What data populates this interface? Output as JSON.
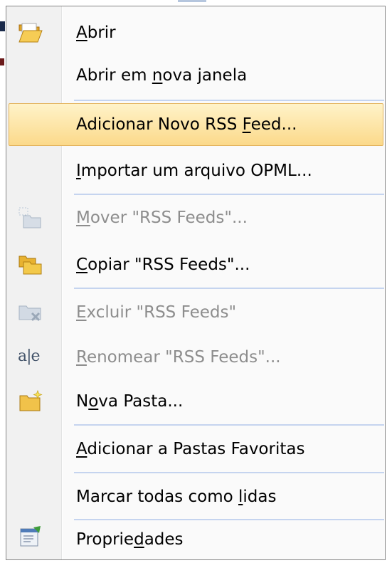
{
  "menu": {
    "items": [
      {
        "pre": "",
        "u": "A",
        "post": "brir",
        "icon": "folder-open-icon",
        "disabled": false
      },
      {
        "pre": "Abrir em ",
        "u": "n",
        "post": "ova janela",
        "icon": "",
        "disabled": false
      },
      {
        "pre": "Adicionar Novo RSS ",
        "u": "F",
        "post": "eed...",
        "icon": "",
        "disabled": false,
        "highlighted": true
      },
      {
        "pre": "",
        "u": "I",
        "post": "mportar um arquivo OPML...",
        "icon": "",
        "disabled": false
      },
      {
        "pre": "",
        "u": "M",
        "post": "over \"RSS Feeds\"...",
        "icon": "move-folder-icon",
        "disabled": true
      },
      {
        "pre": "",
        "u": "C",
        "post": "opiar \"RSS Feeds\"...",
        "icon": "copy-folder-icon",
        "disabled": false
      },
      {
        "pre": "",
        "u": "E",
        "post": "xcluir \"RSS Feeds\"",
        "icon": "delete-folder-icon",
        "disabled": true
      },
      {
        "pre": "",
        "u": "R",
        "post": "enomear \"RSS Feeds\"...",
        "icon": "rename-icon",
        "disabled": true
      },
      {
        "pre": "N",
        "u": "o",
        "post": "va Pasta...",
        "icon": "new-folder-icon",
        "disabled": false
      },
      {
        "pre": "",
        "u": "A",
        "post": "dicionar a Pastas Favoritas",
        "icon": "",
        "disabled": false
      },
      {
        "pre": "Marcar todas como ",
        "u": "l",
        "post": "idas",
        "icon": "",
        "disabled": false
      },
      {
        "pre": "Proprie",
        "u": "d",
        "post": "ades",
        "icon": "properties-icon",
        "disabled": false
      }
    ],
    "rename_icon_text": "a|e",
    "colors": {
      "highlight": "#fbd98a",
      "separator": "#c5d4ef",
      "disabled_text": "#8d8d8d"
    }
  }
}
